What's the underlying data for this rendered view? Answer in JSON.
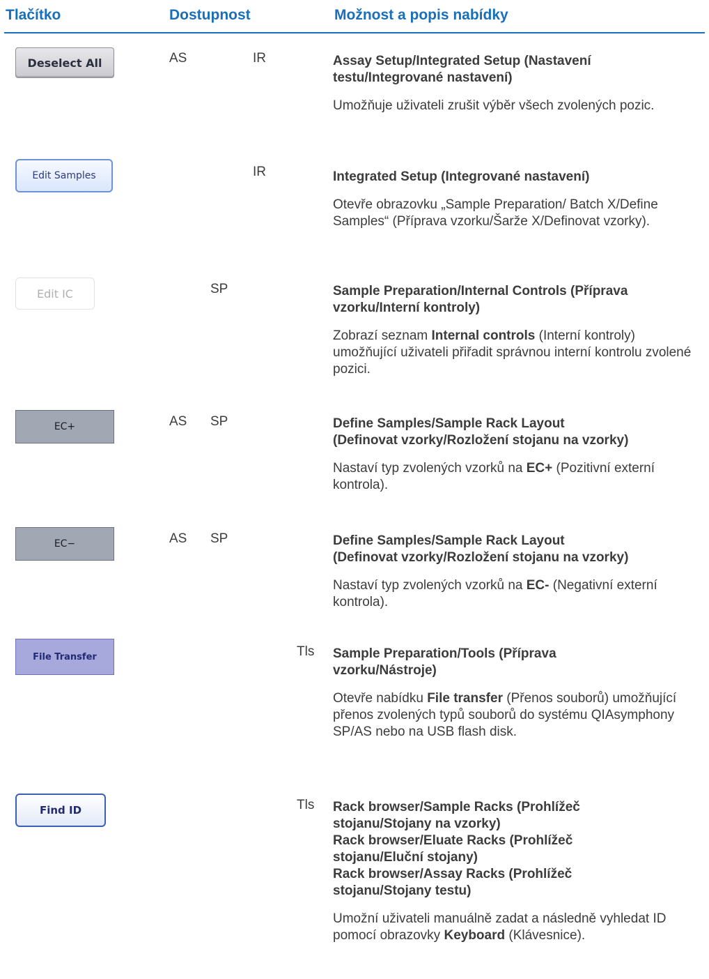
{
  "header": {
    "col1": "Tlačítko",
    "col2": "Dostupnost",
    "col3": "Možnost a popis nabídky"
  },
  "rows": [
    {
      "button": "Deselect All",
      "as": "AS",
      "sp": "",
      "ir": "IR",
      "tls": "",
      "title_lines": [
        "Assay Setup/Integrated Setup (Nastavení",
        "testu/Integrované nastavení)"
      ],
      "desc": [
        "Umožňuje uživateli zrušit výběr všech zvolených pozic."
      ]
    },
    {
      "button": "Edit Samples",
      "as": "",
      "sp": "",
      "ir": "IR",
      "tls": "",
      "title_lines": [
        "Integrated Setup (Integrované nastavení)"
      ],
      "desc": [
        "Otevře obrazovku „Sample Preparation/ Batch X/Define Samples“ (Příprava vzorku/Šarže X/Definovat vzorky)."
      ]
    },
    {
      "button": "Edit IC",
      "as": "",
      "sp": "SP",
      "ir": "",
      "tls": "",
      "title_lines": [
        "Sample Preparation/Internal Controls (Příprava",
        "vzorku/Interní kontroly)"
      ],
      "desc": [
        "Zobrazí seznam ",
        "Internal controls",
        " (Interní kontroly) umožňující uživateli přiřadit správnou interní kontrolu zvolené pozici."
      ]
    },
    {
      "button": "EC+",
      "as": "AS",
      "sp": "SP",
      "ir": "",
      "tls": "",
      "title_lines": [
        "Define Samples/Sample Rack Layout",
        "(Definovat vzorky/Rozložení stojanu na vzorky)"
      ],
      "desc": [
        "Nastaví typ zvolených vzorků na ",
        "EC+",
        " (Pozitivní externí kontrola)."
      ]
    },
    {
      "button": "EC−",
      "as": "AS",
      "sp": "SP",
      "ir": "",
      "tls": "",
      "title_lines": [
        "Define Samples/Sample Rack Layout",
        "(Definovat vzorky/Rozložení stojanu na vzorky)"
      ],
      "desc": [
        "Nastaví typ zvolených vzorků na ",
        "EC-",
        " (Negativní externí kontrola)."
      ]
    },
    {
      "button": "File Transfer",
      "as": "",
      "sp": "",
      "ir": "",
      "tls": "Tls",
      "title_lines": [
        "Sample Preparation/Tools (Příprava",
        "vzorku/Nástroje)"
      ],
      "desc": [
        "Otevře nabídku ",
        "File transfer",
        " (Přenos souborů) umožňující přenos zvolených typů souborů do systému QIAsymphony SP/AS nebo na USB flash disk."
      ]
    },
    {
      "button": "Find ID",
      "as": "",
      "sp": "",
      "ir": "",
      "tls": "Tls",
      "title_lines": [
        "Rack browser/Sample Racks (Prohlížeč",
        "stojanu/Stojany na vzorky)",
        "Rack browser/Eluate Racks (Prohlížeč",
        "stojanu/Eluční stojany)",
        "Rack browser/Assay Racks (Prohlížeč",
        "stojanu/Stojany testu)"
      ],
      "desc": [
        "Umožní uživateli manuálně zadat a následně vyhledat ID pomocí obrazovky ",
        "Keyboard",
        " (Klávesnice)."
      ]
    }
  ]
}
